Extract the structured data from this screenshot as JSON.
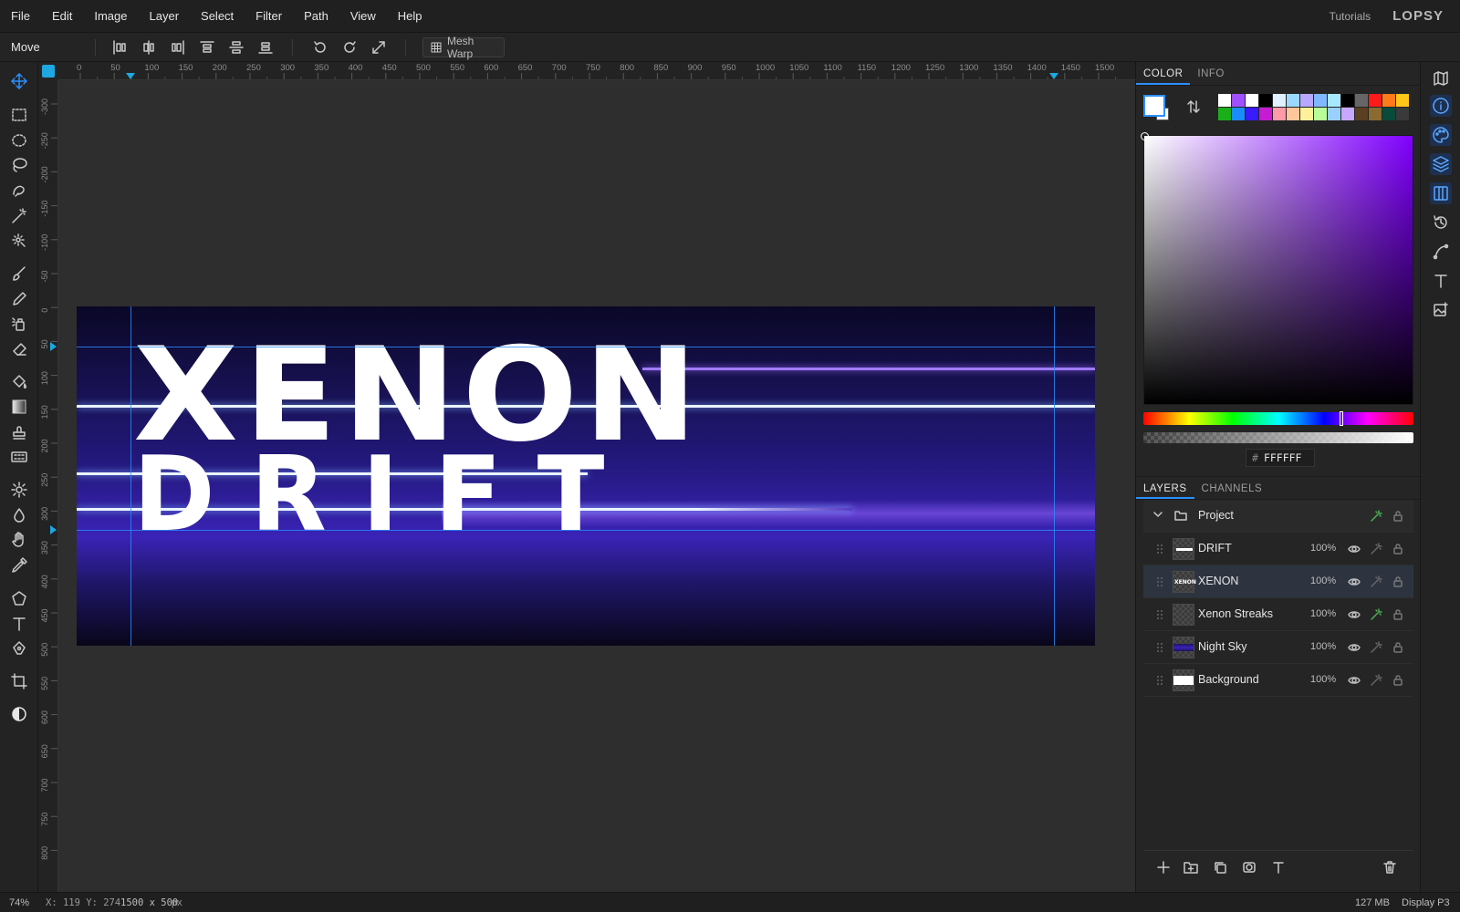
{
  "menubar": {
    "items": [
      "File",
      "Edit",
      "Image",
      "Layer",
      "Select",
      "Filter",
      "Path",
      "View",
      "Help"
    ],
    "tutorials": "Tutorials",
    "logo": "LOPSY"
  },
  "toolbar": {
    "tool_name": "Move",
    "mesh_warp_label": "Mesh Warp"
  },
  "rulers": {
    "h_labels": [
      "0",
      "50",
      "100",
      "150",
      "200",
      "250",
      "300",
      "350",
      "400",
      "450",
      "500",
      "550",
      "600",
      "650",
      "700",
      "750",
      "800",
      "850",
      "900",
      "950",
      "1000",
      "1050",
      "1100",
      "1150",
      "1200",
      "1250",
      "1300",
      "1350",
      "1400",
      "1450",
      "1500"
    ],
    "v_labels": [
      "-300",
      "-250",
      "-200",
      "-150",
      "-100",
      "-50",
      "0",
      "50",
      "100",
      "150",
      "200",
      "250",
      "300",
      "350",
      "400",
      "450",
      "500",
      "550",
      "600",
      "650",
      "700",
      "750",
      "800"
    ]
  },
  "artwork": {
    "title_line1": "XENON",
    "title_line2": "DRIFT"
  },
  "color_panel": {
    "tabs": [
      "COLOR",
      "INFO"
    ],
    "active_tab": "COLOR",
    "foreground": "#ffffff",
    "background": "#ffffff",
    "hex_value": "FFFFFF",
    "hue_color": "#8000ff",
    "palette": [
      "#ffffff",
      "#a050ff",
      "#ffffff",
      "#000000",
      "#e0f0ff",
      "#9ad8ff",
      "#b8a8ff",
      "#7fb8ff",
      "#a8e8ff",
      "#000000",
      "#666666",
      "#ff1a1a",
      "#ff7a1a",
      "#ffc61a",
      "#1aae1a",
      "#1a8cff",
      "#3a1aff",
      "#c81ad0",
      "#ff9aa8",
      "#ffc69a",
      "#fff09a",
      "#b8ff9a",
      "#9ad0ff",
      "#c8a8ff",
      "#5a4020",
      "#8a6a30",
      "#0a4a3a",
      "#3a3a3a"
    ]
  },
  "layers_panel": {
    "tabs": [
      "LAYERS",
      "CHANNELS"
    ],
    "active_tab": "LAYERS",
    "group_name": "Project",
    "layers": [
      {
        "name": "DRIFT",
        "opacity": "100%",
        "selected": false
      },
      {
        "name": "XENON",
        "opacity": "100%",
        "selected": true
      },
      {
        "name": "Xenon Streaks",
        "opacity": "100%",
        "selected": false
      },
      {
        "name": "Night Sky",
        "opacity": "100%",
        "selected": false
      },
      {
        "name": "Background",
        "opacity": "100%",
        "selected": false
      }
    ]
  },
  "status": {
    "zoom": "74%",
    "cursor": "X: 119 Y: 274",
    "doc_size": "1500 x 500",
    "units": "px",
    "memory": "127 MB",
    "color_profile": "Display P3"
  }
}
